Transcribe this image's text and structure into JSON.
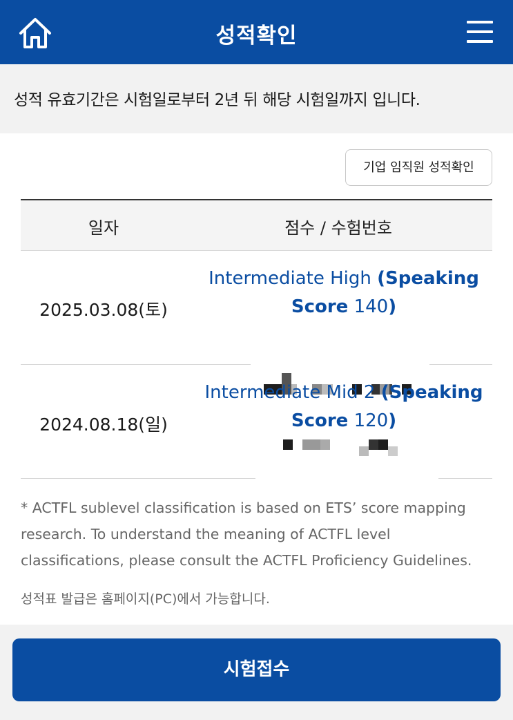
{
  "header": {
    "title": "성적확인",
    "home_icon": "home-icon",
    "menu_icon": "hamburger-menu-icon",
    "background": "#0a4da2"
  },
  "notice": {
    "text": "성적 유효기간은 시험일로부터 2년 뒤 해당 시험일까지 입니다."
  },
  "corporate_button": {
    "label": "기업 임직원 성적확인"
  },
  "table": {
    "columns": [
      "일자",
      "점수 / 수험번호"
    ],
    "rows": [
      {
        "date": "2025.03.08(토)",
        "level": "Intermediate High",
        "speaking_open": "(Speaking",
        "score_word": "Score",
        "score_value": "140",
        "close_paren": ")"
      },
      {
        "date": "2024.08.18(일)",
        "level": "Intermediate Mid 2",
        "speaking_open": "(Speaking",
        "score_word": "Score",
        "score_value": "120",
        "close_paren": ")"
      }
    ]
  },
  "footnote": "* ACTFL sublevel classification is based on ETS’ score mapping research. To understand the meaning of ACTFL level classifications, please consult the ACTFL Proficiency Guidelines.",
  "issuance_note": "성적표 발급은 홈페이지(PC)에서 가능합니다.",
  "apply_button": {
    "label": "시험접수"
  },
  "colors": {
    "brand_blue": "#0a4da2",
    "link_blue": "#0a4da2",
    "notice_bg": "#f2f2f2"
  }
}
